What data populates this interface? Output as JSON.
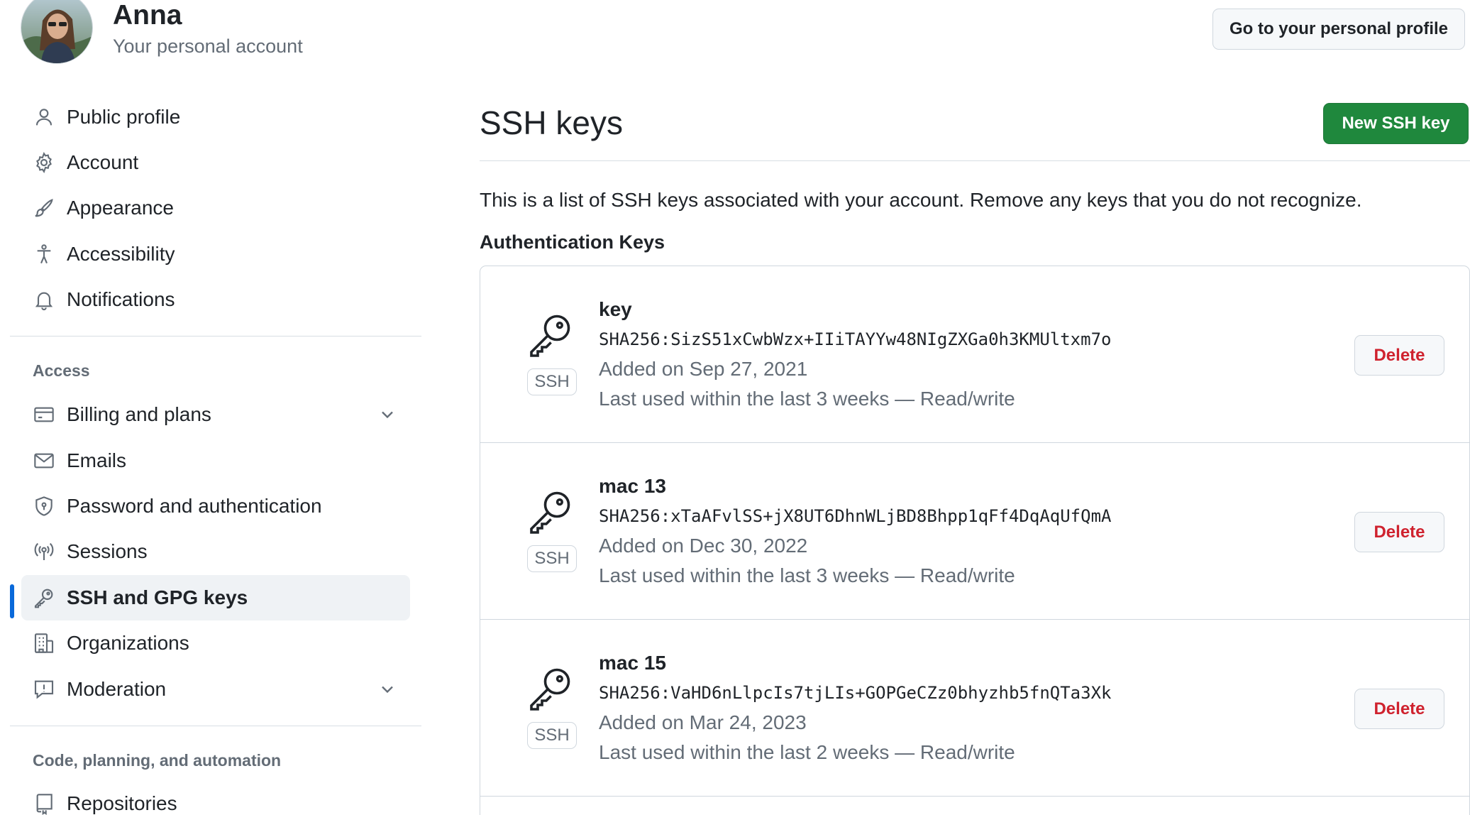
{
  "header": {
    "user_name": "Anna",
    "user_subtitle": "Your personal account",
    "profile_button": "Go to your personal profile"
  },
  "sidebar": {
    "items": [
      {
        "label": "Public profile",
        "icon": "person-icon"
      },
      {
        "label": "Account",
        "icon": "gear-icon"
      },
      {
        "label": "Appearance",
        "icon": "paintbrush-icon"
      },
      {
        "label": "Accessibility",
        "icon": "accessibility-icon"
      },
      {
        "label": "Notifications",
        "icon": "bell-icon"
      }
    ],
    "access_heading": "Access",
    "access_items": [
      {
        "label": "Billing and plans",
        "icon": "credit-card-icon",
        "expandable": true
      },
      {
        "label": "Emails",
        "icon": "mail-icon"
      },
      {
        "label": "Password and authentication",
        "icon": "shield-icon"
      },
      {
        "label": "Sessions",
        "icon": "broadcast-icon"
      },
      {
        "label": "SSH and GPG keys",
        "icon": "key-icon",
        "active": true
      },
      {
        "label": "Organizations",
        "icon": "organization-icon"
      },
      {
        "label": "Moderation",
        "icon": "report-icon",
        "expandable": true
      }
    ],
    "code_heading": "Code, planning, and automation",
    "code_items": [
      {
        "label": "Repositories",
        "icon": "repo-icon"
      }
    ]
  },
  "main": {
    "title": "SSH keys",
    "new_button": "New SSH key",
    "intro": "This is a list of SSH keys associated with your account. Remove any keys that you do not recognize.",
    "section_heading": "Authentication Keys",
    "keys": [
      {
        "name": "key",
        "fingerprint": "SHA256:SizS51xCwbWzx+IIiTAYYw48NIgZXGa0h3KMUltxm7o",
        "added": "Added on Sep 27, 2021",
        "last_used": "Last used within the last 3 weeks — Read/write",
        "badge": "SSH",
        "delete_label": "Delete"
      },
      {
        "name": "mac 13",
        "fingerprint": "SHA256:xTaAFvlSS+jX8UT6DhnWLjBD8Bhpp1qFf4DqAqUfQmA",
        "added": "Added on Dec 30, 2022",
        "last_used": "Last used within the last 3 weeks — Read/write",
        "badge": "SSH",
        "delete_label": "Delete"
      },
      {
        "name": "mac 15",
        "fingerprint": "SHA256:VaHD6nLlpcIs7tjLIs+GOPGeCZz0bhyzhb5fnQTa3Xk",
        "added": "Added on Mar 24, 2023",
        "last_used": "Last used within the last 2 weeks — Read/write",
        "badge": "SSH",
        "delete_label": "Delete"
      }
    ]
  },
  "colors": {
    "accent": "#0969da",
    "primary_button": "#1f883d",
    "danger": "#cf222e",
    "muted_text": "#636c76"
  }
}
